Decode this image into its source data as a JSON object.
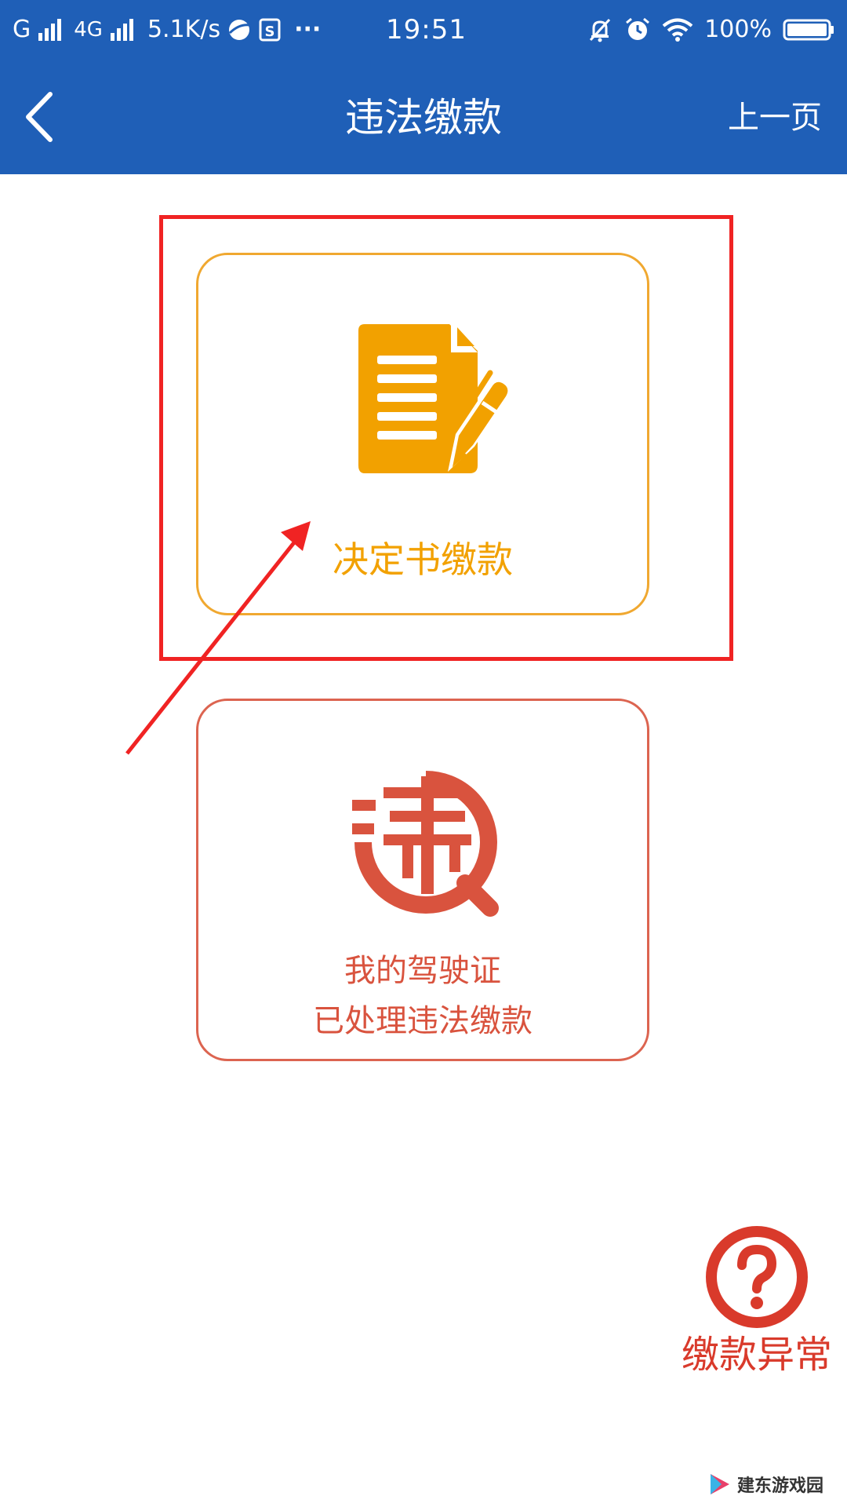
{
  "status_bar": {
    "carrier_1": "G",
    "carrier_2": "4G",
    "net_speed": "5.1K/s",
    "notification_more": "···",
    "time": "19:51",
    "battery": "100%",
    "icons": [
      "signal-bars-icon",
      "browser-icon",
      "s-app-icon",
      "mute-bell-icon",
      "alarm-icon",
      "wifi-icon",
      "battery-icon"
    ]
  },
  "nav": {
    "back_icon": "chevron-left-icon",
    "title": "违法缴款",
    "prev_label": "上一页"
  },
  "cards": {
    "decision": {
      "icon": "document-pen-icon",
      "label": "决定书缴款",
      "color": "#f2a100"
    },
    "violation": {
      "icon": "wei-magnifier-icon",
      "line1": "我的驾驶证",
      "line2": "已处理违法缴款",
      "color": "#d9533e"
    }
  },
  "help": {
    "icon": "question-circle-icon",
    "label": "缴款异常",
    "color": "#d93a2b"
  },
  "annotation": {
    "color": "#f02323",
    "box_icon": "highlight-rectangle",
    "arrow_icon": "red-arrow-icon"
  },
  "watermark": {
    "icon": "play-triangle-icon",
    "text": "建东游戏园"
  },
  "colors": {
    "header_bg": "#1f5fb7",
    "background": "#ffffff"
  }
}
